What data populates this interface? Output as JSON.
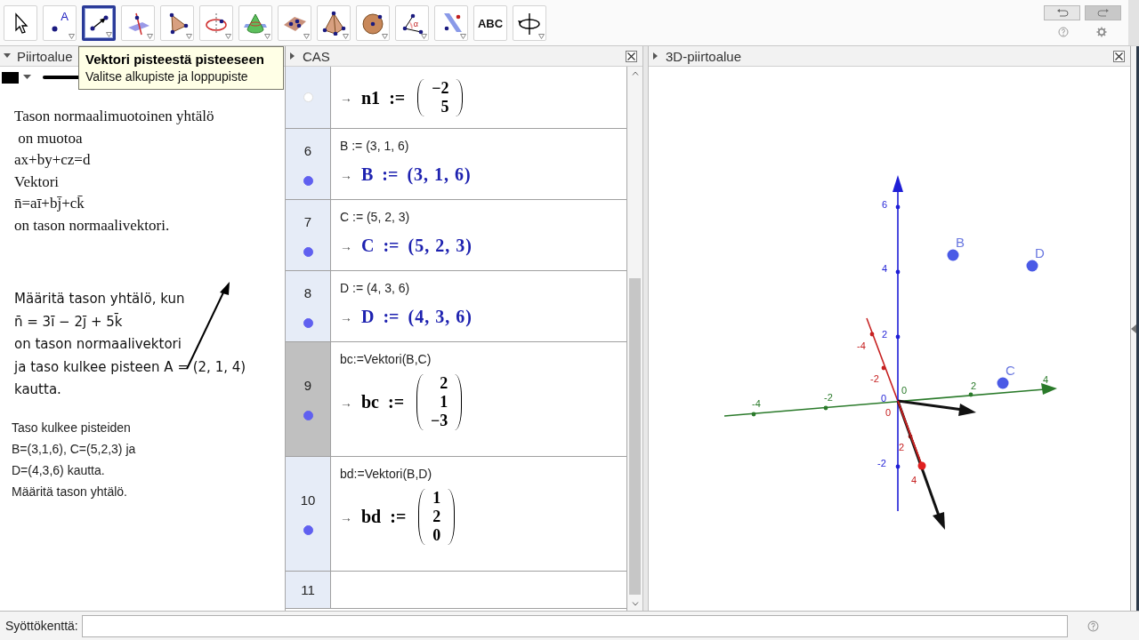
{
  "toolbar": {
    "tools": [
      {
        "kind": "move",
        "selected": false,
        "menu": false
      },
      {
        "kind": "point",
        "label": "A",
        "selected": false,
        "menu": true
      },
      {
        "kind": "vector",
        "selected": true,
        "menu": true
      },
      {
        "kind": "intersect",
        "selected": false,
        "menu": true
      },
      {
        "kind": "polygon",
        "selected": false,
        "menu": true
      },
      {
        "kind": "circle-axis",
        "selected": false,
        "menu": true
      },
      {
        "kind": "cone",
        "selected": false,
        "menu": true
      },
      {
        "kind": "plane",
        "selected": false,
        "menu": true
      },
      {
        "kind": "pyramid",
        "selected": false,
        "menu": true
      },
      {
        "kind": "sphere",
        "selected": false,
        "menu": true
      },
      {
        "kind": "angle",
        "label": "α",
        "selected": false,
        "menu": true
      },
      {
        "kind": "parallel-plane",
        "selected": false,
        "menu": true
      },
      {
        "kind": "text",
        "label": "ABC",
        "selected": false,
        "menu": false
      },
      {
        "kind": "rotate",
        "selected": false,
        "menu": true
      }
    ],
    "undo": {
      "disabled": false
    },
    "redo": {
      "disabled": true
    }
  },
  "tooltip": {
    "title": "Vektori pisteestä pisteeseen",
    "text": "Valitse alkupiste ja loppupiste"
  },
  "graphics": {
    "title": "Piirtoalue",
    "expanded": true,
    "blocks": [
      {
        "kind": "serif",
        "lines": [
          "Tason normaalimuotoinen yhtälö",
          " on muotoa",
          "ax+by+cz=d",
          "Vektori",
          "n̄=aī+bj̄+ck̄",
          "on tason normaalivektori."
        ]
      },
      {
        "kind": "math",
        "lines": [
          "Määritä tason yhtälö, kun",
          "n̄ = 3ī − 2j̄ + 5k̄",
          "on tason normaalivektori",
          "ja taso kulkee pisteen A = (2, 1, 4)",
          "kautta."
        ]
      },
      {
        "kind": "plain",
        "lines": [
          "Taso kulkee pisteiden",
          "B=(3,1,6), C=(5,2,3) ja",
          "D=(4,3,6) kautta.",
          "Määritä tason yhtälö."
        ]
      }
    ]
  },
  "cas": {
    "title": "CAS",
    "rows": [
      {
        "visible": false,
        "selected": false,
        "output": {
          "kind": "vector",
          "arrow": "→",
          "name": "n1",
          "operator": ":=",
          "components": [
            "−2",
            "5"
          ]
        }
      },
      {
        "number": "6",
        "visible": true,
        "selected": false,
        "input": "B := (3, 1, 6)",
        "output": {
          "kind": "point",
          "arrow": "→",
          "name": "B",
          "operator": ":=",
          "value": "(3, 1, 6)"
        }
      },
      {
        "number": "7",
        "visible": true,
        "selected": false,
        "input": "C := (5, 2, 3)",
        "output": {
          "kind": "point",
          "arrow": "→",
          "name": "C",
          "operator": ":=",
          "value": "(5, 2, 3)"
        }
      },
      {
        "number": "8",
        "visible": true,
        "selected": false,
        "input": "D := (4, 3, 6)",
        "output": {
          "kind": "point",
          "arrow": "→",
          "name": "D",
          "operator": ":=",
          "value": "(4, 3, 6)"
        }
      },
      {
        "number": "9",
        "visible": true,
        "selected": true,
        "input": "bc:=Vektori(B,C)",
        "output": {
          "kind": "vector",
          "arrow": "→",
          "name": "bc",
          "operator": ":=",
          "components": [
            "2",
            "1",
            "−3"
          ]
        }
      },
      {
        "number": "10",
        "visible": true,
        "selected": false,
        "input": "bd:=Vektori(B,D)",
        "output": {
          "kind": "vector",
          "arrow": "→",
          "name": "bd",
          "operator": ":=",
          "components": [
            "1",
            "2",
            "0"
          ]
        }
      },
      {
        "number": "11",
        "selected": false
      }
    ]
  },
  "view_3d": {
    "title": "3D-piirtoalue",
    "axes": [
      {
        "kind": "x",
        "tick_labels": [
          "-4",
          "-2",
          "0",
          "2",
          "4"
        ]
      },
      {
        "kind": "y",
        "tick_labels": [
          "-4",
          "-2",
          "0",
          "2",
          "4"
        ]
      },
      {
        "kind": "z",
        "tick_labels": [
          "6",
          "4",
          "2",
          "0",
          "-2"
        ]
      }
    ],
    "points": [
      {
        "label": "B"
      },
      {
        "label": "D"
      },
      {
        "label": "C"
      }
    ]
  },
  "input_bar": {
    "label": "Syöttökenttä:"
  }
}
